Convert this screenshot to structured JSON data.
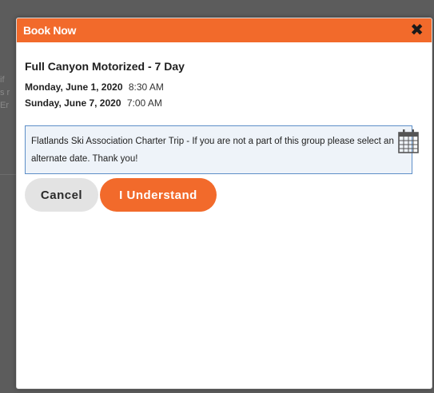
{
  "background": {
    "fragments": [
      "if",
      "s r",
      "Er"
    ]
  },
  "modal": {
    "title": "Book Now",
    "close_icon": "close-icon",
    "trip_name": "Full Canyon Motorized - 7 Day",
    "start": {
      "date": "Monday, June 1, 2020",
      "time": "8:30 AM"
    },
    "end": {
      "date": "Sunday, June 7, 2020",
      "time": "7:00 AM"
    },
    "calendar_icon": "calendar-icon",
    "notice": "Flatlands Ski Association Charter Trip - If you are not a part of this group please select an alternate date. Thank you!",
    "cancel_label": "Cancel",
    "confirm_label": "I Understand"
  },
  "colors": {
    "accent": "#f26a2b",
    "notice_border": "#5e8fc8",
    "notice_bg": "#eef3f9",
    "cancel_bg": "#e3e3e3"
  }
}
